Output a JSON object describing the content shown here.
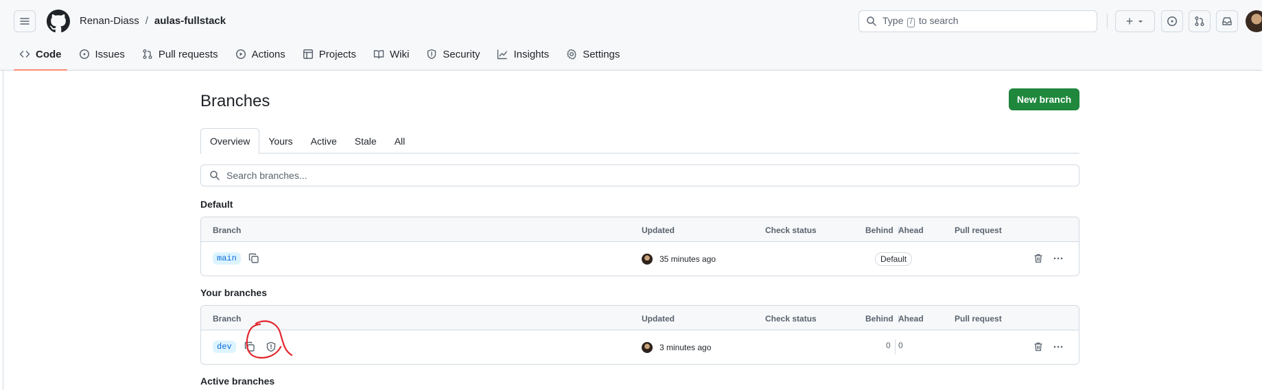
{
  "header": {
    "owner": "Renan-Diass",
    "separator": "/",
    "repo": "aulas-fullstack",
    "search_prefix": "Type",
    "search_key": "/",
    "search_suffix": "to search",
    "create_symbol": "+"
  },
  "nav": {
    "items": [
      {
        "label": "Code",
        "icon": "code-icon",
        "active": true
      },
      {
        "label": "Issues",
        "icon": "issue-opened-icon"
      },
      {
        "label": "Pull requests",
        "icon": "git-pull-request-icon"
      },
      {
        "label": "Actions",
        "icon": "play-icon"
      },
      {
        "label": "Projects",
        "icon": "table-icon"
      },
      {
        "label": "Wiki",
        "icon": "book-icon"
      },
      {
        "label": "Security",
        "icon": "shield-icon"
      },
      {
        "label": "Insights",
        "icon": "graph-icon"
      },
      {
        "label": "Settings",
        "icon": "gear-icon"
      }
    ]
  },
  "page": {
    "title": "Branches",
    "new_branch_label": "New branch"
  },
  "tabs": [
    "Overview",
    "Yours",
    "Active",
    "Stale",
    "All"
  ],
  "selected_tab": "Overview",
  "branch_search": {
    "placeholder": "Search branches..."
  },
  "table_headers": {
    "branch": "Branch",
    "updated": "Updated",
    "check_status": "Check status",
    "behind": "Behind",
    "ahead": "Ahead",
    "pull_request": "Pull request"
  },
  "sections": {
    "default": {
      "title": "Default",
      "row": {
        "branch": "main",
        "updated": "35 minutes ago",
        "badge": "Default"
      }
    },
    "yours": {
      "title": "Your branches",
      "row": {
        "branch": "dev",
        "updated": "3 minutes ago",
        "behind": "0",
        "ahead": "0"
      }
    },
    "active": {
      "title": "Active branches"
    }
  },
  "colors": {
    "primary_button": "#1f883d",
    "accent_underline": "#fd8c73",
    "branch_label_bg": "#ddf4ff",
    "branch_label_fg": "#0969da",
    "annotation_red": "#e3242b"
  }
}
